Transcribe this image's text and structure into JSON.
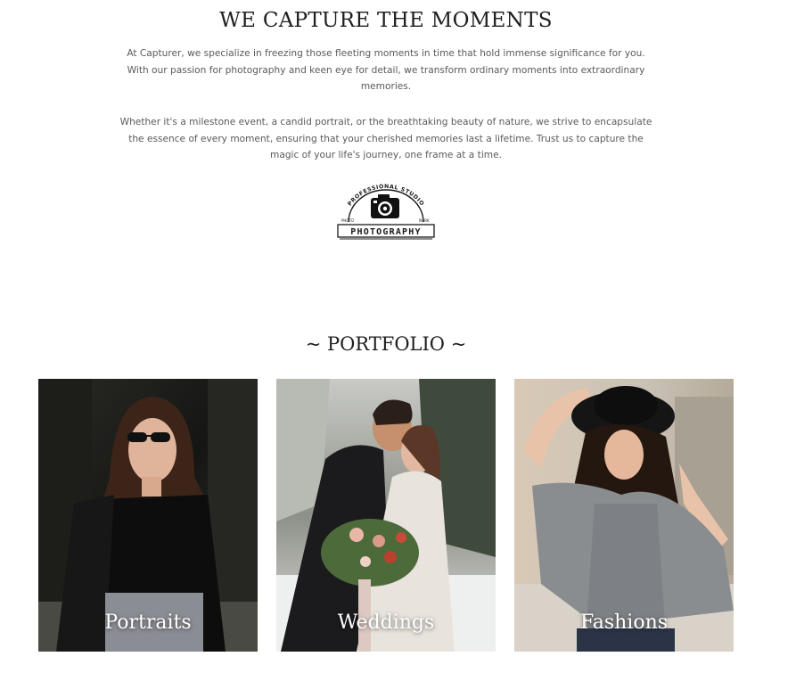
{
  "about": {
    "title": "WE CAPTURE THE MOMENTS",
    "paragraph_1": "At Capturer, we specialize in freezing those fleeting moments in time that hold immense significance for you. With our passion for photography and keen eye for detail, we transform ordinary moments into extraordinary memories.",
    "paragraph_2": "Whether it's a milestone event, a candid portrait, or the breathtaking beauty of nature, we strive to encapsulate the essence of every moment, ensuring that your cherished memories last a lifetime. Trust us to capture the magic of your life's journey, one frame at a time."
  },
  "logo": {
    "arc_text": "PROFESSIONAL STUDIO",
    "left_small": "PHOTO",
    "right_small": "MARK",
    "word": "PHOTOGRAPHY",
    "icon": "camera-icon"
  },
  "portfolio": {
    "title": "~ PORTFOLIO ~",
    "items": [
      {
        "label": "Portraits"
      },
      {
        "label": "Weddings"
      },
      {
        "label": "Fashions"
      }
    ]
  }
}
